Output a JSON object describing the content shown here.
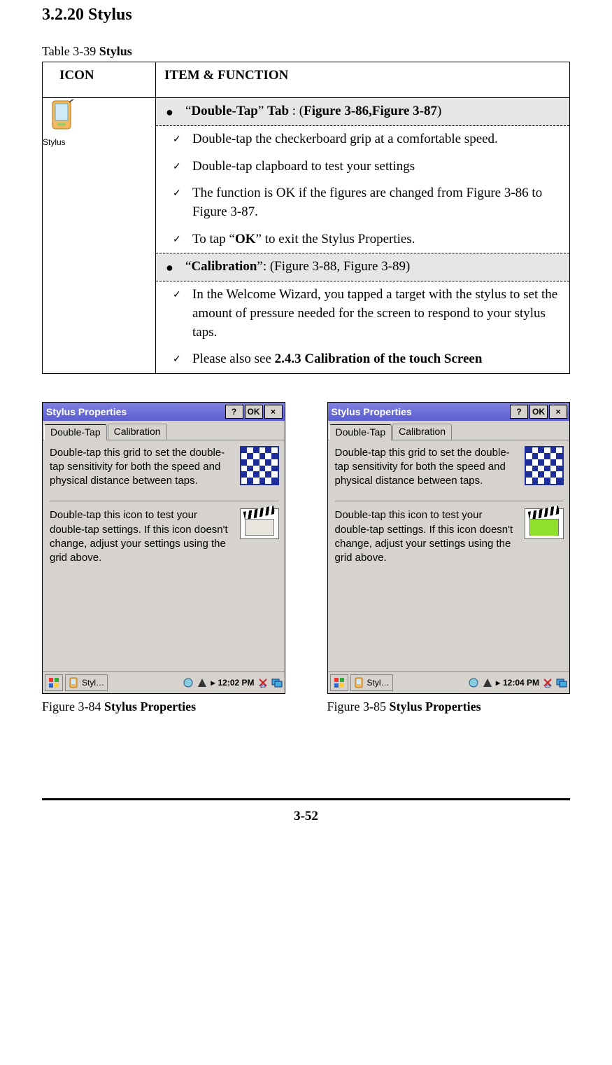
{
  "section": {
    "number": "3.2.20",
    "title": "Stylus"
  },
  "table": {
    "caption_prefix": "Table 3-39 ",
    "caption_bold": "Stylus",
    "header_icon": "ICON",
    "header_item": "ITEM & FUNCTION",
    "icon_label": "Stylus",
    "rows": [
      {
        "type": "header",
        "text_parts": [
          "“",
          "Double-Tap",
          "” ",
          "Tab",
          " : (",
          "Figure 3-86,Figure 3-87",
          ")"
        ]
      },
      {
        "type": "check",
        "text": "Double-tap the checkerboard grip at a comfortable speed."
      },
      {
        "type": "check",
        "text": "Double-tap clapboard to test your settings"
      },
      {
        "type": "check",
        "text": "The function is OK if the figures are changed from Figure 3-86 to Figure 3-87."
      },
      {
        "type": "check",
        "text_parts": [
          "To tap “",
          "OK",
          "” to exit the Stylus Properties."
        ]
      },
      {
        "type": "header2",
        "text_parts": [
          "“",
          "Calibration",
          "”: (Figure 3-88, Figure 3-89)"
        ]
      },
      {
        "type": "check",
        "text": "In the Welcome Wizard, you tapped a target with the stylus to set the amount of pressure needed for the screen to respond to your stylus taps."
      },
      {
        "type": "check",
        "text_parts": [
          "Please also see ",
          "2.4.3 Calibration of the touch Screen"
        ]
      }
    ]
  },
  "figures": [
    {
      "titlebar": "Stylus Properties",
      "tabs": [
        "Double-Tap",
        "Calibration"
      ],
      "active_tab": 0,
      "para1": "Double-tap this grid to set the double-tap sensitivity for both the speed and physical distance between taps.",
      "para2": "Double-tap this icon to test your double-tap settings. If this icon doesn't change, adjust your settings using the grid above.",
      "taskbar_app": "Styl…",
      "clock": "12:02 PM",
      "clap_style": "plain",
      "caption_prefix": "Figure 3-84 ",
      "caption_bold": "Stylus Properties"
    },
    {
      "titlebar": "Stylus Properties",
      "tabs": [
        "Double-Tap",
        "Calibration"
      ],
      "active_tab": 0,
      "para1": "Double-tap this grid to set the double-tap sensitivity for both the speed and physical distance between taps.",
      "para2": "Double-tap this icon to test your double-tap settings. If this icon doesn't change, adjust your settings using the grid above.",
      "taskbar_app": "Styl…",
      "clock": "12:04 PM",
      "clap_style": "green",
      "caption_prefix": "Figure 3-85 ",
      "caption_bold": "Stylus Properties"
    }
  ],
  "buttons": {
    "help": "?",
    "ok": "OK",
    "close": "×"
  },
  "page_number": "3-52"
}
